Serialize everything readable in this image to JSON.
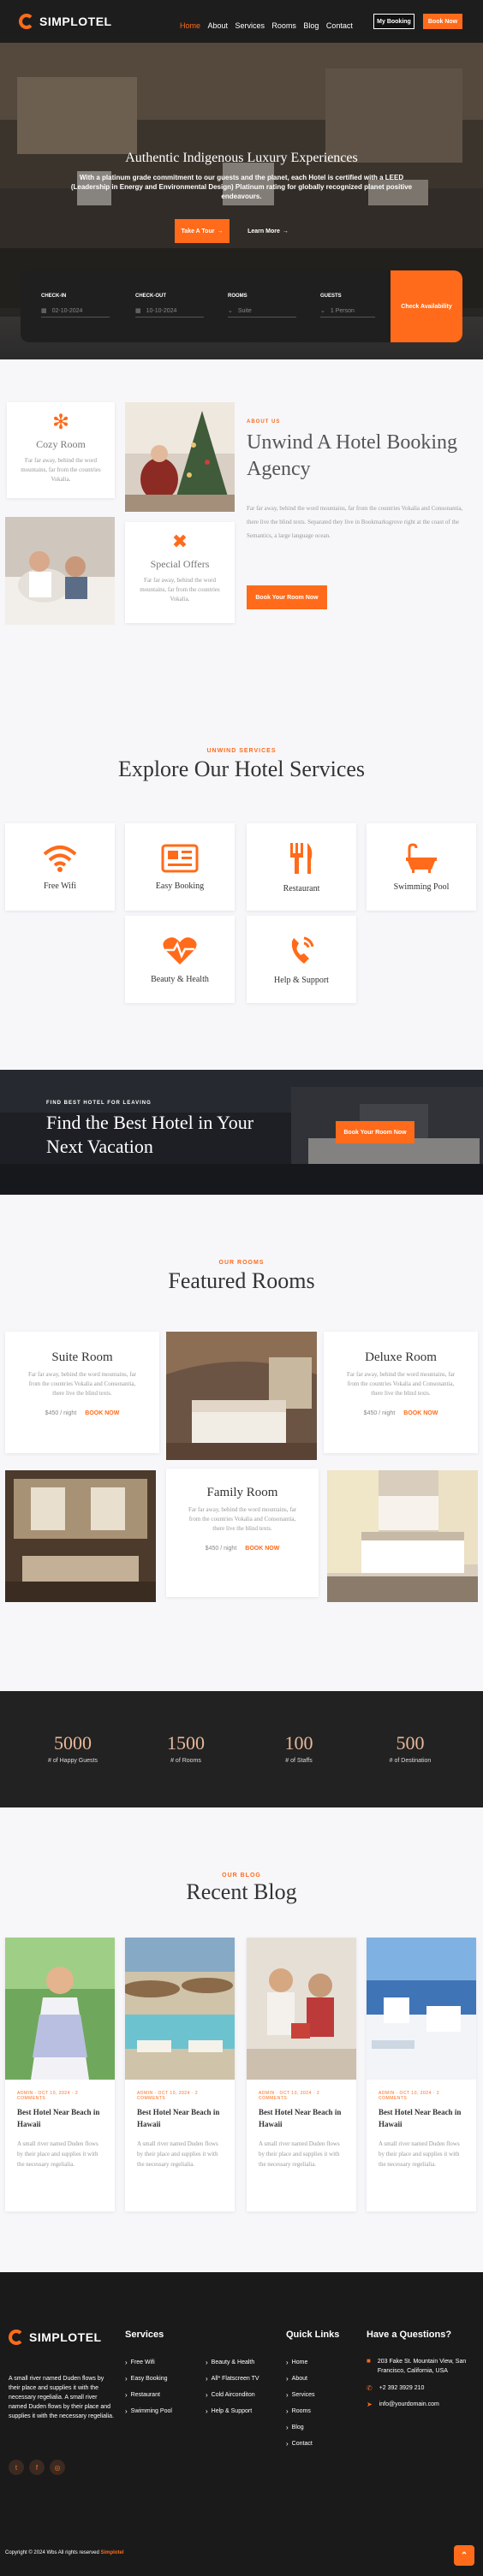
{
  "brand": {
    "name": "SIMPLOTEL",
    "accent": "#ff6b1a"
  },
  "nav": {
    "items": [
      "Home",
      "About",
      "Services",
      "Rooms",
      "Blog",
      "Contact"
    ],
    "my_booking": "My Booking",
    "book_now": "Book Now"
  },
  "hero": {
    "title": "Authentic Indigenous Luxury Experiences",
    "subtitle": "With a platinum grade commitment to our guests and the planet, each Hotel is certified with a LEED (Leadership in Energy and Environmental Design) Platinum rating for globally recognized planet positive endeavours.",
    "take_tour": "Take A Tour",
    "learn_more": "Learn More"
  },
  "booking": {
    "checkin_label": "CHECK-IN",
    "checkin_value": "02-10-2024",
    "checkout_label": "CHECK-OUT",
    "checkout_value": "10-10-2024",
    "rooms_label": "ROOMS",
    "rooms_value": "Suite",
    "guests_label": "GUESTS",
    "guests_value": "1 Person",
    "button": "Check Availability"
  },
  "about": {
    "cozy_title": "Cozy Room",
    "cozy_text": "Far far away, behind the word mountains, far from the countries Vokalia.",
    "special_title": "Special Offers",
    "special_text": "Far far away, behind the word mountains, far from the countries Vokalia.",
    "kicker": "ABOUT US",
    "title": "Unwind A Hotel Booking Agency",
    "text": "Far far away, behind the word mountains, far from the countries Vokalia and Consonantia, there live the blind texts. Separated they live in Bookmarksgrove right at the coast of the Semantics, a large language ocean.",
    "button": "Book Your Room Now"
  },
  "services": {
    "kicker": "UNWIND SERVICES",
    "title": "Explore Our Hotel Services",
    "items": [
      {
        "label": "Free Wifi",
        "icon": "wifi-icon"
      },
      {
        "label": "Easy Booking",
        "icon": "newspaper-icon"
      },
      {
        "label": "Restaurant",
        "icon": "utensils-icon"
      },
      {
        "label": "Swimming Pool",
        "icon": "bathtub-icon"
      },
      {
        "label": "Beauty & Health",
        "icon": "heartbeat-icon"
      },
      {
        "label": "Help & Support",
        "icon": "phone-icon"
      }
    ]
  },
  "cta": {
    "kicker": "FIND BEST HOTEL FOR LEAVING",
    "title": "Find the Best Hotel in Your Next Vacation",
    "button": "Book Your Room Now"
  },
  "rooms": {
    "kicker": "OUR ROOMS",
    "title": "Featured Rooms",
    "text": "Far far away, behind the word mountains, far from the countries Vokalia and Consonantia, there live the blind texts.",
    "items": [
      {
        "name": "Suite Room",
        "price": "$450 / night",
        "book": "BOOK NOW"
      },
      {
        "name": "Deluxe Room",
        "price": "$450 / night",
        "book": "BOOK NOW"
      },
      {
        "name": "Family Room",
        "price": "$450 / night",
        "book": "BOOK NOW"
      }
    ]
  },
  "stats": [
    {
      "value": "5000",
      "label": "# of Happy Guests"
    },
    {
      "value": "1500",
      "label": "# of Rooms"
    },
    {
      "value": "100",
      "label": "# of Staffs"
    },
    {
      "value": "500",
      "label": "# of Destination"
    }
  ],
  "blog": {
    "kicker": "OUR BLOG",
    "title": "Recent Blog",
    "posts": [
      {
        "meta": "ADMIN · OCT 10, 2024 · 2 COMMENTS",
        "title": "Best Hotel Near Beach in Hawaii",
        "text": "A small river named Duden flows by their place and supplies it with the necessary regelialia."
      },
      {
        "meta": "ADMIN · OCT 10, 2024 · 2 COMMENTS",
        "title": "Best Hotel Near Beach in Hawaii",
        "text": "A small river named Duden flows by their place and supplies it with the necessary regelialia."
      },
      {
        "meta": "ADMIN · OCT 10, 2024 · 2 COMMENTS",
        "title": "Best Hotel Near Beach in Hawaii",
        "text": "A small river named Duden flows by their place and supplies it with the necessary regelialia."
      },
      {
        "meta": "ADMIN · OCT 10, 2024 · 2 COMMENTS",
        "title": "Best Hotel Near Beach in Hawaii",
        "text": "A small river named Duden flows by their place and supplies it with the necessary regelialia."
      }
    ]
  },
  "footer": {
    "about": "A small river named Duden flows by their place and supplies it with the necessary regelialia. A small river named Duden flows by their place and supplies it with the necessary regelialia.",
    "services_title": "Services",
    "services_col1": [
      "Free Wifi",
      "Easy Booking",
      "Restaurant",
      "Swimming Pool"
    ],
    "services_col2": [
      "Beauty & Health",
      "All* Flatscreen TV",
      "Cold Airconditon",
      "Help & Support"
    ],
    "links_title": "Quick Links",
    "links": [
      "Home",
      "About",
      "Services",
      "Rooms",
      "Blog",
      "Contact"
    ],
    "contact_title": "Have a Questions?",
    "address": "203 Fake St. Mountain View, San Francisco, California, USA",
    "phone": "+2 392 3929 210",
    "email": "info@yourdomain.com",
    "copyright": "Copyright © 2024 Wbs All rights reserved",
    "copyright_brand": "Simplotel"
  }
}
